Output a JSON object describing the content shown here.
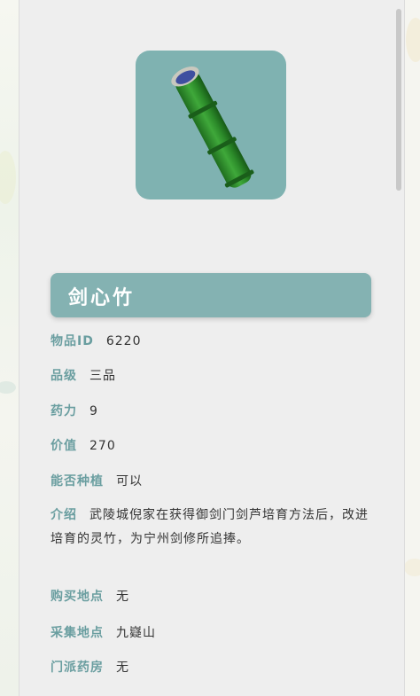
{
  "item": {
    "name": "剑心竹",
    "image_icon": "green-bamboo-icon"
  },
  "fields": {
    "id": {
      "label": "物品ID",
      "value": "6220"
    },
    "grade": {
      "label": "品级",
      "value": "三品"
    },
    "potency": {
      "label": "药力",
      "value": "9"
    },
    "price": {
      "label": "价值",
      "value": "270"
    },
    "plantable": {
      "label": "能否种植",
      "value": "可以"
    },
    "intro": {
      "label": "介绍",
      "value": "武陵城倪家在获得御剑门剑芦培育方法后，改进培育的灵竹，为宁州剑修所追捧。"
    },
    "buy_location": {
      "label": "购买地点",
      "value": "无"
    },
    "gather_location": {
      "label": "采集地点",
      "value": "九嶷山"
    },
    "sect_herb_room": {
      "label": "门派药房",
      "value": "无"
    }
  },
  "colors": {
    "accent": "#84b2b2",
    "label": "#6a9ea0",
    "image_bg": "#7fb2b1"
  }
}
